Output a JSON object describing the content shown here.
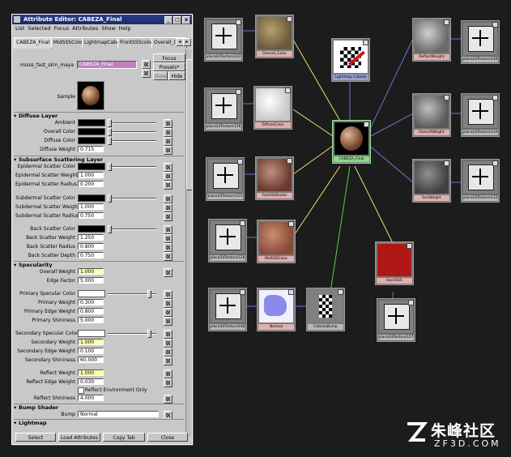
{
  "window": {
    "title": "Attribute Editor: CABEZA_Final",
    "min_label": "_",
    "max_label": "□",
    "close_label": "x"
  },
  "menu": [
    "List",
    "Selected",
    "Focus",
    "Attributes",
    "Show",
    "Help"
  ],
  "tabs": [
    "CABEZA_Final",
    "MidSSSColor",
    "LightmapCabeza",
    "FrontSSScolor",
    "Overall_Colo"
  ],
  "header": {
    "type_label": "misss_fast_skin_maya",
    "node_value": "CABEZA_Final",
    "focus_label": "Focus",
    "presets_label": "Presets*",
    "show_label": "Show",
    "hide_label": "Hide",
    "sample_label": "Sample"
  },
  "sections": {
    "diffuse": "Diffuse Layer",
    "sss": "Subsurface Scattering Layer",
    "specularity": "Specularity",
    "bump": "Bump Shader",
    "lightmap": "Lightmap"
  },
  "attrs": {
    "ambient": "Ambient",
    "overall_color": "Overall Color",
    "diffuse_color": "Diffuse Color",
    "diffuse_weight": "Diffuse Weight",
    "diffuse_weight_val": "0.715",
    "epi_color": "Epidermal Scatter Color",
    "epi_weight": "Epidermal Scatter Weight",
    "epi_weight_val": "1.000",
    "epi_radius": "Epidermal Scatter Radius",
    "epi_radius_val": "0.200",
    "sub_color": "Subdermal Scatter Color",
    "sub_weight": "Subdermal Scatter Weight",
    "sub_weight_val": "1.000",
    "sub_radius": "Subdermal Scatter Radius",
    "sub_radius_val": "0.750",
    "back_color": "Back Scatter Color",
    "back_weight": "Back Scatter Weight",
    "back_weight_val": "1.250",
    "back_radius": "Back Scatter Radius",
    "back_radius_val": "0.800",
    "back_depth": "Back Scatter Depth",
    "back_depth_val": "0.750",
    "overall_weight": "Overall Weight",
    "overall_weight_val": "1.000",
    "edge_factor": "Edge Factor",
    "edge_factor_val": "5.000",
    "prim_color": "Primary Specular Color",
    "prim_weight": "Primary Weight",
    "prim_weight_val": "0.300",
    "prim_edge": "Primary Edge Weight",
    "prim_edge_val": "0.800",
    "prim_shin": "Primary Shininess",
    "prim_shin_val": "5.000",
    "sec_color": "Secondary Specular Color",
    "sec_weight": "Secondary Weight",
    "sec_weight_val": "1.000",
    "sec_edge": "Secondary Edge Weight",
    "sec_edge_val": "0.100",
    "sec_shin": "Secondary Shininess",
    "sec_shin_val": "60.000",
    "refl_weight": "Reflect Weight",
    "refl_weight_val": "1.000",
    "refl_edge": "Reflect Edge Weight",
    "refl_edge_val": "0.030",
    "refl_env": "Reflect Environment Only",
    "refl_shin": "Reflect Shininess",
    "refl_shin_val": "4.000",
    "bump": "Bump",
    "bump_val": "Normal"
  },
  "bottom": {
    "select": "Select",
    "load": "Load Attributes",
    "copy": "Copy Tab",
    "close": "Close"
  },
  "nodes": {
    "p1": "place2dTexture122",
    "overall": "Overall_Color",
    "p2": "place2dTexture126",
    "diffuse": "DiffuseColor",
    "p3": "place2dTexture125",
    "front": "FrontSSScolor",
    "p4": "place2dTexture128",
    "mid": "MidSSSColor",
    "p5": "place2dTexture108",
    "normal": "Normal",
    "cabezabump": "CabezaBump",
    "lightmap": "Lightmap Cabeza",
    "final": "CABEZA_Final",
    "reflect": "ReflectWeight",
    "p6": "place2dTexture149",
    "overallw": "OverallWeight",
    "p7": "place2dTexture134",
    "secw": "SecWeight",
    "p8": "place2dTexture133",
    "back": "BackSSS",
    "p9": "place2dTexture127"
  },
  "watermark": {
    "chinese": "朱峰社区",
    "url": "ZF3D.COM"
  },
  "colors": {
    "title_bar": "#1f3278",
    "back_sss": "#b01818",
    "node_selected": "#8ad88a",
    "lightmap_label": "#9aa0d8",
    "yellow_line": "#e8e070",
    "blue_line": "#7070d8",
    "green_line": "#50d050"
  }
}
